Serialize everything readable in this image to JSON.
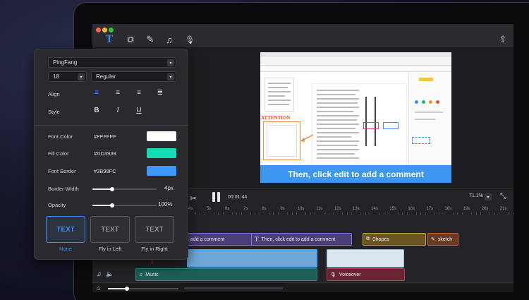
{
  "toolbar": {
    "tools": [
      {
        "name": "text-tool",
        "glyph": "T"
      },
      {
        "name": "shapes-tool",
        "glyph": "⧉"
      },
      {
        "name": "sketch-tool",
        "glyph": "✎"
      },
      {
        "name": "music-tool",
        "glyph": "♫"
      },
      {
        "name": "voice-tool",
        "glyph": "🎙"
      }
    ],
    "export_glyph": "⇪"
  },
  "preview": {
    "attention_label": "ATTENTION",
    "caption": "Then, click edit to add a comment"
  },
  "panel": {
    "font_family": "PingFang",
    "font_size": "18",
    "font_weight": "Regular",
    "align_label": "Align",
    "style_label": "Style",
    "align_options": [
      "align-left",
      "align-center",
      "align-right",
      "align-justify"
    ],
    "style_options": {
      "bold": "B",
      "italic": "I",
      "underline": "U"
    },
    "font_color_label": "Font Color",
    "font_color": "#FFFFFF",
    "fill_color_label": "Fill Color",
    "fill_color": "#DD3939",
    "fill_swatch": "#14dcb4",
    "font_border_label": "Font Border",
    "font_border": "#3B99FC",
    "border_swatch": "#3b99fc",
    "border_width_label": "Border Width",
    "border_width": "4px",
    "border_width_level": 0.3,
    "opacity_label": "Opacity",
    "opacity": "100%",
    "opacity_level": 0.3,
    "animations": [
      {
        "box": "TEXT",
        "caption": "None",
        "active": true
      },
      {
        "box": "TEXT",
        "caption": "Fly in Left",
        "active": false
      },
      {
        "box": "TEXT",
        "caption": "Fly in Right",
        "active": false
      }
    ]
  },
  "timeline": {
    "current_time": "00:01:44",
    "zoom": "71.1%",
    "ticks": [
      "4s",
      "5s",
      "6s",
      "7s",
      "8s",
      "9s",
      "10s",
      "11s",
      "12s",
      "13s",
      "14s",
      "15s",
      "16s",
      "17s",
      "18s",
      "19s",
      "20s",
      "21s"
    ],
    "clips": {
      "text1": "add a comment",
      "text2": "Then,  click edit to add a comment",
      "shapes": "Shapes",
      "sketch": "sketch",
      "music": "Music",
      "voiceover": "Voiceover"
    }
  }
}
